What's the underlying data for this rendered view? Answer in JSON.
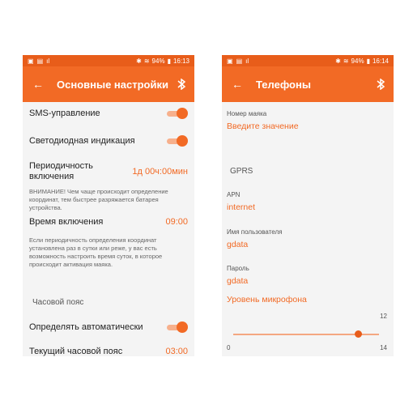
{
  "left": {
    "status": {
      "time": "16:13",
      "battery": "94%"
    },
    "title": "Основные настройки",
    "sms_label": "SMS-управление",
    "led_label": "Светодиодная индикация",
    "period_label": "Периодичность включения",
    "period_value": "1д 00ч:00мин",
    "warning": "ВНИМАНИЕ! Чем чаще происходит определение координат, тем быстрее разряжается батарея устройства.",
    "time_label": "Время включения",
    "time_value": "09:00",
    "info": "Если периодичность определения координат установлена раз в сутки или реже, у вас есть возможность настроить время суток, в которое происходит активация маяка.",
    "tz_section": "Часовой пояс",
    "auto_label": "Определять автоматически",
    "current_tz_label": "Текущий часовой пояс",
    "current_tz_value": "03:00"
  },
  "right": {
    "status": {
      "time": "16:14",
      "battery": "94%"
    },
    "title": "Телефоны",
    "beacon_number_label": "Номер маяка",
    "beacon_number_placeholder": "Введите значение",
    "gprs_section": "GPRS",
    "apn_label": "APN",
    "apn_value": "internet",
    "username_label": "Имя пользователя",
    "username_value": "gdata",
    "password_label": "Пароль",
    "password_value": "gdata",
    "mic_label": "Уровень микрофона",
    "mic_value": "12",
    "mic_min": "0",
    "mic_max": "14"
  },
  "colors": {
    "accent": "#f26a25",
    "statusbar": "#e85d1a"
  }
}
